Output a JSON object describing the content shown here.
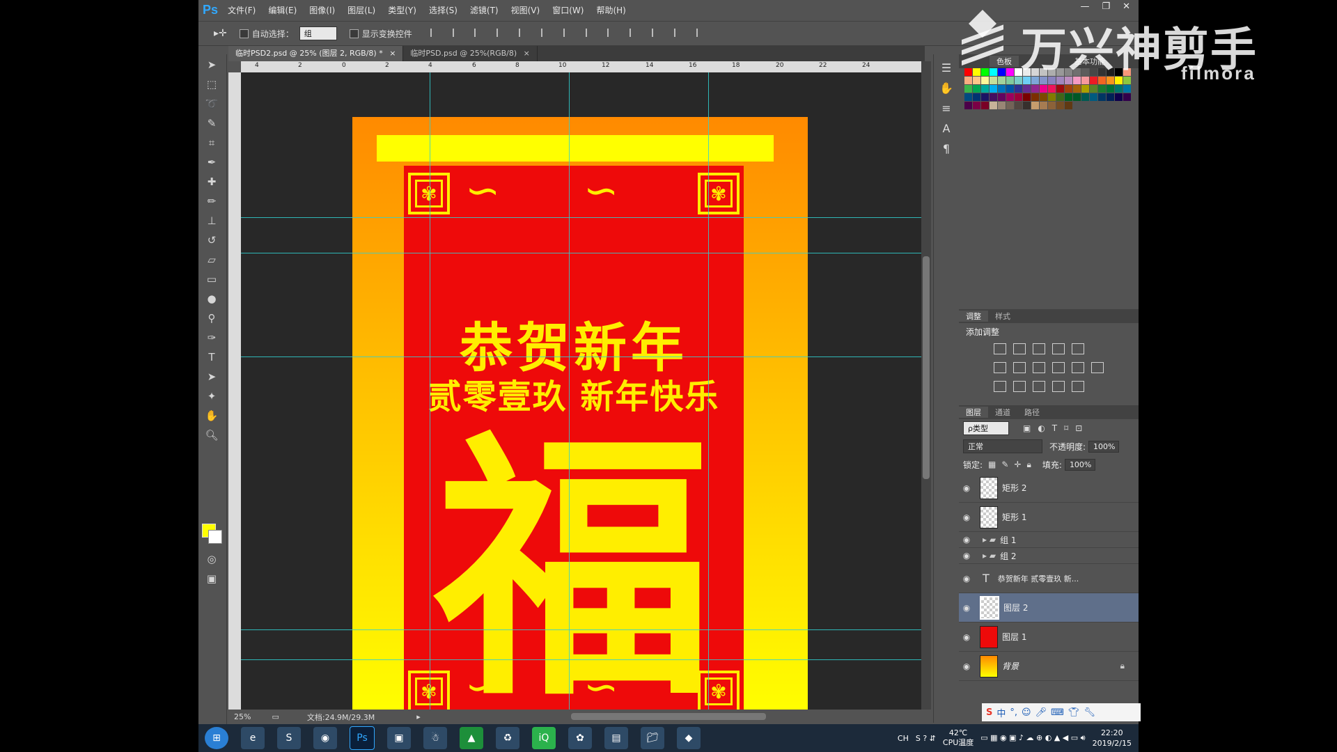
{
  "app": {
    "logo": "Ps",
    "menus": [
      "文件(F)",
      "编辑(E)",
      "图像(I)",
      "图层(L)",
      "类型(Y)",
      "选择(S)",
      "滤镜(T)",
      "视图(V)",
      "窗口(W)",
      "帮助(H)"
    ],
    "window_controls": [
      "—",
      "❐",
      "✕"
    ]
  },
  "options": {
    "auto_select_label": "自动选择：",
    "auto_select_value": "组",
    "show_transform_label": "显示变换控件"
  },
  "tabs": [
    {
      "label": "临时PSD2.psd @ 25% (图层 2, RGB/8) *",
      "close": "×"
    },
    {
      "label": "临时PSD.psd @ 25%(RGB/8)",
      "close": "×"
    }
  ],
  "ruler_top_ticks": [
    "4",
    "2",
    "0",
    "2",
    "4",
    "6",
    "8",
    "10",
    "12",
    "14",
    "16",
    "18",
    "20",
    "22",
    "24"
  ],
  "artwork": {
    "line1": "恭贺新年",
    "line2": "贰零壹玖  新年快乐",
    "main_char": "福"
  },
  "status": {
    "zoom": "25%",
    "doc_size": "文档:24.9M/29.3M"
  },
  "right_panel": {
    "workspace": "基本功能",
    "swatch_tab_label": "色板",
    "swatch_colors": [
      "#ff0000",
      "#ffff00",
      "#00ff00",
      "#00ffff",
      "#0000ff",
      "#ff00ff",
      "#ffffff",
      "#ebebeb",
      "#d6d6d6",
      "#c2c2c2",
      "#adadad",
      "#999999",
      "#858585",
      "#707070",
      "#5c5c5c",
      "#474747",
      "#333333",
      "#1f1f1f",
      "#000000",
      "#f7977a",
      "#f9ad81",
      "#fdc68a",
      "#fff79a",
      "#c4df9b",
      "#a2d39c",
      "#82ca9d",
      "#7bcdc8",
      "#6ecff6",
      "#7ea7d8",
      "#8493ca",
      "#8882be",
      "#a187be",
      "#bc8dbf",
      "#f49ac2",
      "#f6989d",
      "#ed1c24",
      "#f26522",
      "#f7941d",
      "#fff200",
      "#8dc73f",
      "#39b54a",
      "#00a651",
      "#00a99d",
      "#00aeef",
      "#0072bc",
      "#0054a6",
      "#2e3192",
      "#662d91",
      "#92278f",
      "#ec008c",
      "#ed145b",
      "#9e0b0f",
      "#a0410d",
      "#a3620a",
      "#aba000",
      "#598527",
      "#1a7b30",
      "#007236",
      "#00746b",
      "#0076a3",
      "#004b80",
      "#003471",
      "#1b1464",
      "#440e62",
      "#630460",
      "#9e005d",
      "#9e0039",
      "#790000",
      "#7b2e00",
      "#7d4900",
      "#827b00",
      "#406618",
      "#005e20",
      "#005826",
      "#005952",
      "#005b7f",
      "#003663",
      "#002157",
      "#0d004c",
      "#32004b",
      "#4b0049",
      "#7b0046",
      "#7a0026",
      "#c7b299",
      "#998675",
      "#736357",
      "#534741",
      "#37302d",
      "#c69c6d",
      "#a67c52",
      "#8c6239",
      "#754c24",
      "#603913"
    ],
    "adjust_tabs": [
      "调整",
      "样式"
    ],
    "add_adjustment": "添加调整",
    "layers_tabs": [
      "图层",
      "通道",
      "路径"
    ],
    "filter_kind": "ρ类型",
    "blend_mode": "正常",
    "opacity_label": "不透明度:",
    "opacity_value": "100%",
    "lock_label": "锁定:",
    "fill_label": "填充:",
    "fill_value": "100%",
    "layers": [
      {
        "name": "矩形 2",
        "type": "shape"
      },
      {
        "name": "矩形 1",
        "type": "shape"
      },
      {
        "name": "组 1",
        "type": "group"
      },
      {
        "name": "组 2",
        "type": "group"
      },
      {
        "name": "恭贺新年 贰零壹玖 新...",
        "type": "text"
      },
      {
        "name": "图层 2",
        "type": "pixel",
        "selected": true
      },
      {
        "name": "图层 1",
        "type": "red"
      },
      {
        "name": "背景",
        "type": "bg"
      }
    ]
  },
  "taskbar": {
    "tray_text": "CH",
    "temp": "42℃",
    "temp_label": "CPU温度",
    "time": "22:20",
    "date": "2019/2/15",
    "ime_label": "中"
  },
  "watermark": {
    "cn": "万兴神剪手",
    "en": "filmora"
  }
}
